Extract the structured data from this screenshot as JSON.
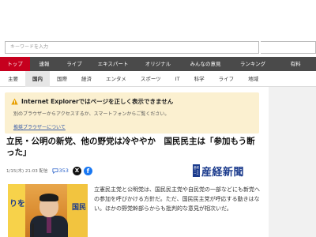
{
  "search": {
    "placeholder": "キーワードを入力"
  },
  "nav_main": [
    {
      "label": "トップ",
      "active": true
    },
    {
      "label": "速報"
    },
    {
      "label": "ライブ"
    },
    {
      "label": "エキスパート"
    },
    {
      "label": "オリジナル"
    },
    {
      "label": "みんなの意見"
    },
    {
      "label": "ランキング"
    },
    {
      "label": "有料"
    }
  ],
  "nav_sub": [
    {
      "label": "主要"
    },
    {
      "label": "国内",
      "active": true
    },
    {
      "label": "国際"
    },
    {
      "label": "経済"
    },
    {
      "label": "エンタメ"
    },
    {
      "label": "スポーツ"
    },
    {
      "label": "IT"
    },
    {
      "label": "科学"
    },
    {
      "label": "ライフ"
    },
    {
      "label": "地域"
    }
  ],
  "ie_warning": {
    "title": "Internet Explorerではページを正しく表示できません",
    "text": "別のブラウザーからアクセスするか、スマートフォンからご覧ください。",
    "link": "推奨ブラウザーについて"
  },
  "article": {
    "headline": "立民・公明の新党、他の野党は冷ややか　国民民主は「参加もう断った」",
    "date": "1/15(木) 21:03 配信",
    "comment_count": "353",
    "publisher": "産経新聞",
    "publisher_mark": [
      "産経",
      "ニュース"
    ],
    "photo_banner_left": "りを",
    "photo_banner_right": "国民",
    "body": "立憲民主党と公明党は、国民民主党や自民党の一部などにも新党への参加を呼びかける方針だ。ただ、国民民主党が呼応する動きはない。ほかの野党幹部らからも批判的な意見が相次いだ。"
  },
  "colors": {
    "nav_bg": "#4a4a4a",
    "nav_active": "#c6001e",
    "warning_bg": "#fbf0d0",
    "brand": "#1a3a8c",
    "link": "#2a62c9"
  }
}
